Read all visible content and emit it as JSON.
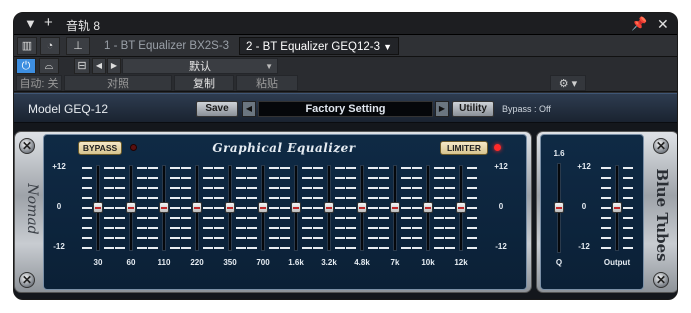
{
  "window": {
    "title": "音轨 8",
    "tabs": [
      {
        "label": "1 - BT Equalizer BX2S-3",
        "active": false
      },
      {
        "label": "2 - BT Equalizer GEQ12-3",
        "active": true
      }
    ],
    "preset": "默认",
    "auto_label": "自动: 关",
    "compare_label": "对照",
    "copy_label": "复制",
    "paste_label": "粘贴"
  },
  "plugin": {
    "model": "Model GEQ-12",
    "save_label": "Save",
    "preset_name": "Factory Setting",
    "utility_label": "Utility",
    "bypass_status": "Bypass : Off",
    "title": "Graphical Equalizer",
    "bypass_button": "BYPASS",
    "limiter_button": "LIMITER",
    "scale": [
      "+12",
      "0",
      "-12"
    ],
    "bands": [
      {
        "freq": "30",
        "gain_db": 0
      },
      {
        "freq": "60",
        "gain_db": 0
      },
      {
        "freq": "110",
        "gain_db": 0
      },
      {
        "freq": "220",
        "gain_db": 0
      },
      {
        "freq": "350",
        "gain_db": 0
      },
      {
        "freq": "700",
        "gain_db": 0
      },
      {
        "freq": "1.6k",
        "gain_db": 0
      },
      {
        "freq": "3.2k",
        "gain_db": 0
      },
      {
        "freq": "4.8k",
        "gain_db": 0
      },
      {
        "freq": "7k",
        "gain_db": 0
      },
      {
        "freq": "10k",
        "gain_db": 0
      },
      {
        "freq": "12k",
        "gain_db": 0
      }
    ],
    "q": {
      "label": "Q",
      "top": "1.6",
      "value_fraction": 0.5
    },
    "output": {
      "label": "Output",
      "gain_db": 0
    },
    "brand": "Blue Tubes",
    "signature": "Nomad"
  },
  "colors": {
    "accent": "#3d8ee0",
    "led_red": "#ff2a2a",
    "panel": "#0f2a45"
  }
}
